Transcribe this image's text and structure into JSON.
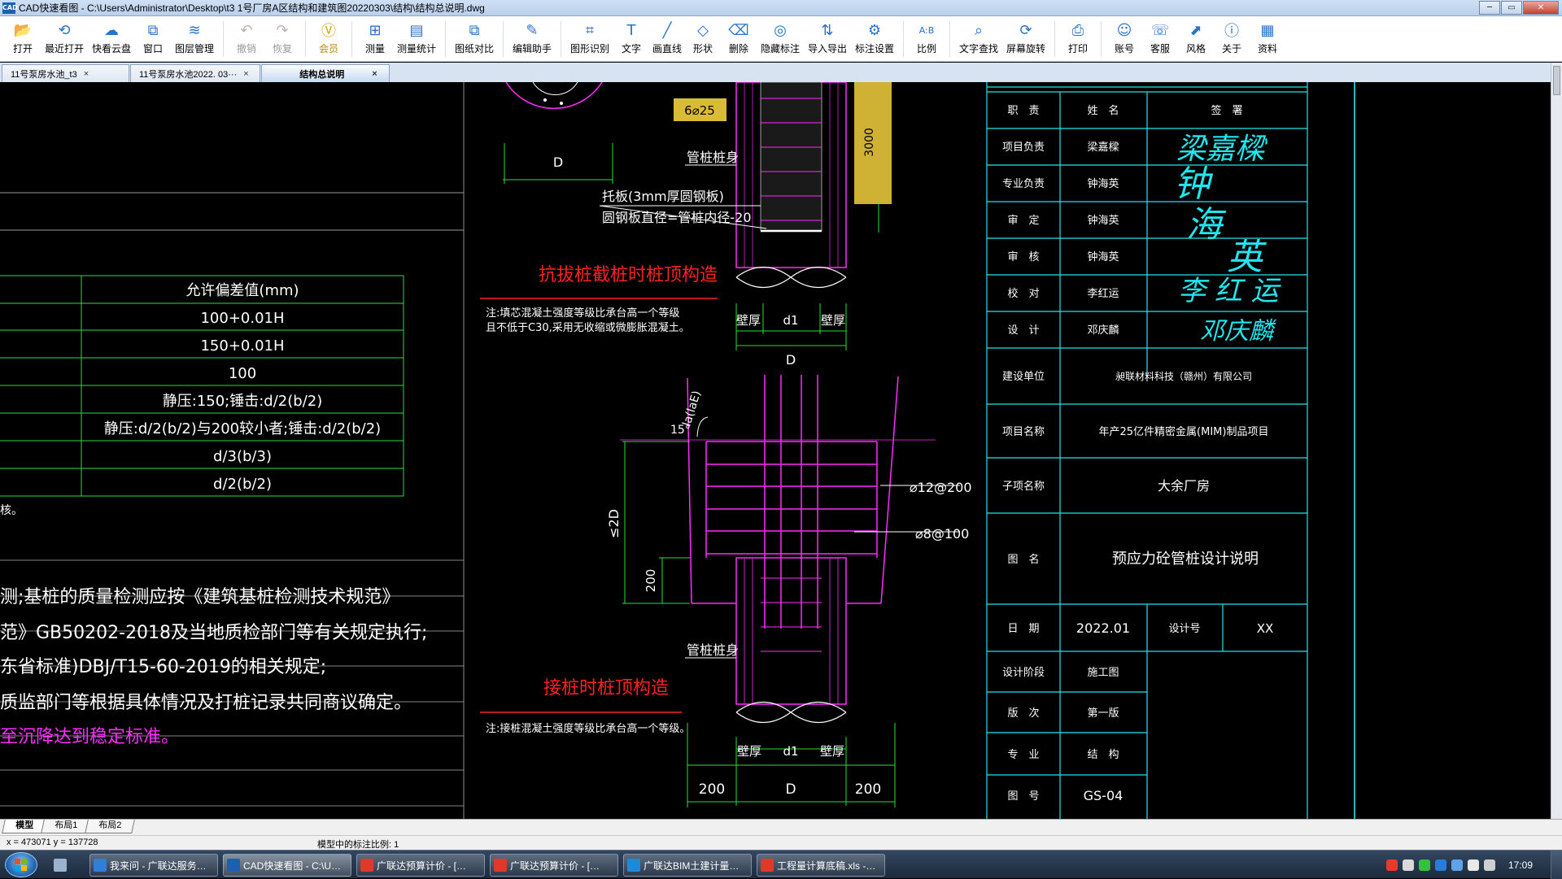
{
  "window": {
    "title": "CAD快速看图 - C:\\Users\\Administrator\\Desktop\\t3 1号厂房A区结构和建筑图20220303\\结构\\结构总说明.dwg",
    "app_icon_text": "CAD",
    "buttons": [
      "─",
      "▭",
      "✕"
    ]
  },
  "toolbar": [
    {
      "label": "打开",
      "icon": "folder-icon",
      "glyph": "📂"
    },
    {
      "label": "最近打开",
      "icon": "history-icon",
      "glyph": "⟲"
    },
    {
      "label": "快看云盘",
      "icon": "cloud-icon",
      "glyph": "☁"
    },
    {
      "label": "窗口",
      "icon": "window-icon",
      "glyph": "⧉"
    },
    {
      "label": "图层管理",
      "icon": "layers-icon",
      "glyph": "≋"
    },
    {
      "label": "撤销",
      "icon": "undo-icon",
      "glyph": "↶",
      "disabled": true
    },
    {
      "label": "恢复",
      "icon": "redo-icon",
      "glyph": "↷",
      "disabled": true
    },
    {
      "label": "会员",
      "icon": "vip-icon",
      "glyph": "Ⓥ",
      "vip": true
    },
    {
      "label": "测量",
      "icon": "measure-icon",
      "glyph": "⊞"
    },
    {
      "label": "测量统计",
      "icon": "measure-stats-icon",
      "glyph": "▤"
    },
    {
      "label": "图纸对比",
      "icon": "compare-icon",
      "glyph": "⧉"
    },
    {
      "label": "编辑助手",
      "icon": "edit-assistant-icon",
      "glyph": "✎"
    },
    {
      "label": "图形识别",
      "icon": "shape-recognition-icon",
      "glyph": "⌗"
    },
    {
      "label": "文字",
      "icon": "text-icon",
      "glyph": "T"
    },
    {
      "label": "画直线",
      "icon": "line-icon",
      "glyph": "╱"
    },
    {
      "label": "形状",
      "icon": "shape-icon",
      "glyph": "◇"
    },
    {
      "label": "删除",
      "icon": "eraser-icon",
      "glyph": "⌫"
    },
    {
      "label": "隐藏标注",
      "icon": "hide-annotation-icon",
      "glyph": "◎"
    },
    {
      "label": "导入导出",
      "icon": "import-export-icon",
      "glyph": "⇅"
    },
    {
      "label": "标注设置",
      "icon": "annotation-settings-icon",
      "glyph": "⚙"
    },
    {
      "label": "比例",
      "icon": "scale-icon",
      "glyph": "A:B"
    },
    {
      "label": "文字查找",
      "icon": "text-search-icon",
      "glyph": "⌕"
    },
    {
      "label": "屏幕旋转",
      "icon": "rotate-screen-icon",
      "glyph": "⟳"
    },
    {
      "label": "打印",
      "icon": "print-icon",
      "glyph": "⎙"
    },
    {
      "label": "账号",
      "icon": "account-icon",
      "glyph": "☺"
    },
    {
      "label": "客服",
      "icon": "support-icon",
      "glyph": "☏"
    },
    {
      "label": "风格",
      "icon": "style-icon",
      "glyph": "⬈"
    },
    {
      "label": "关于",
      "icon": "about-icon",
      "glyph": "ⓘ"
    },
    {
      "label": "资料",
      "icon": "resources-icon",
      "glyph": "▦"
    }
  ],
  "doc_tabs": [
    {
      "label": "11号泵房水池_t3",
      "close": "×"
    },
    {
      "label": "11号泵房水池2022. 03···",
      "close": "×"
    },
    {
      "label": "结构总说明",
      "close": "×",
      "active": true
    }
  ],
  "drawing": {
    "tolerance_table": {
      "header": "允许偏差值(mm)",
      "rows": [
        "100+0.01H",
        "150+0.01H",
        "100",
        "静压:150;锤击:d/2(b/2)",
        "静压:d/2(b/2)与200较小者;锤击:d/2(b/2)",
        "d/3(b/3)",
        "d/2(b/2)"
      ],
      "tail": "核。"
    },
    "notes": [
      "测;基桩的质量检测应按《建筑基桩检测技术规范》",
      "范》GB50202-2018及当地质检部门等有关规定执行;",
      "东省标准)DBJ/T15-60-2019的相关规定;",
      "质监部门等根据具体情况及打桩记录共同商议确定。",
      "至沉降达到稳定标准。"
    ],
    "detail_top": {
      "dim_d": "D",
      "rebar_label": "6⌀25",
      "dim_3000": "3000",
      "pile_body": "管桩桩身",
      "plate": "托板(3mm厚圆钢板)",
      "plate_dia": "圆钢板直径=管桩内径-20",
      "title": "抗拔桩截桩时桩顶构造",
      "note1": "注:填芯混凝土强度等级比承台高一个等级",
      "note2": "且不低于C30,采用无收缩或微膨胀混凝土。",
      "dims": [
        "壁厚",
        "d1",
        "壁厚"
      ],
      "dim_D": "D"
    },
    "detail_bottom": {
      "la": "la(laE)",
      "angle": "15°",
      "le2d": "≤2D",
      "d200": "200",
      "rebar1": "⌀12@200",
      "rebar2": "⌀8@100",
      "pile_body": "管桩桩身",
      "title": "接桩时桩顶构造",
      "note": "注:接桩混凝土强度等级比承台高一个等级。",
      "dims": [
        "壁厚",
        "d1",
        "壁厚"
      ],
      "bottom_dims": [
        "200",
        "D",
        "200"
      ]
    },
    "title_block": {
      "sig_header": [
        "职　责",
        "姓　名",
        "签　署"
      ],
      "roles": [
        {
          "role": "项目负责",
          "name": "梁嘉樑",
          "sign": "梁嘉樑"
        },
        {
          "role": "专业负责",
          "name": "钟海英",
          "sign": "钟"
        },
        {
          "role": "审　定",
          "name": "钟海英",
          "sign": "海"
        },
        {
          "role": "审　核",
          "name": "钟海英",
          "sign": "英"
        },
        {
          "role": "校　对",
          "name": "李红运",
          "sign": "李 红 运"
        },
        {
          "role": "设　计",
          "name": "邓庆麟",
          "sign": "邓庆麟"
        }
      ],
      "client_label": "建设单位",
      "client": "昶联材料科技（赣州）有限公司",
      "project_label": "项目名称",
      "project": "年产25亿件精密金属(MIM)制品项目",
      "sub_label": "子项名称",
      "sub": "大余厂房",
      "drawing_name_label": "图　名",
      "drawing_name": "预应力砼管桩设计说明",
      "date_label": "日　期",
      "date": "2022.01",
      "design_no_label": "设计号",
      "design_no": "XX",
      "stage_label": "设计阶段",
      "stage": "施工图",
      "version_label": "版　次",
      "version": "第一版",
      "discipline_label": "专　业",
      "discipline": "结　构",
      "sheet_label": "图　号",
      "sheet": "GS-04"
    }
  },
  "layout_tabs": [
    "模型",
    "布局1",
    "布局2"
  ],
  "status": {
    "coords": "x = 473071  y = 137728",
    "scale": "模型中的标注比例: 1"
  },
  "taskbar": {
    "items": [
      {
        "label": "我来问 - 广联达服务…",
        "color": "#2f7fd6"
      },
      {
        "label": "CAD快速看图 - C:\\U…",
        "color": "#1d5fb0",
        "active": true
      },
      {
        "label": "广联达预算计价 - […",
        "color": "#e0382b"
      },
      {
        "label": "广联达预算计价 - […",
        "color": "#e0382b"
      },
      {
        "label": "广联达BIM土建计量…",
        "color": "#1b8ad8"
      },
      {
        "label": "工程量计算底稿.xls -…",
        "color": "#e0382b"
      }
    ],
    "clock": "17:09"
  },
  "colors": {
    "cad_white": "#ffffff",
    "cad_green": "#27e036",
    "cad_magenta": "#ff2bff",
    "cad_cyan": "#22e6ee",
    "cad_red": "#ff2020",
    "cad_yellow": "#e6c53a"
  }
}
